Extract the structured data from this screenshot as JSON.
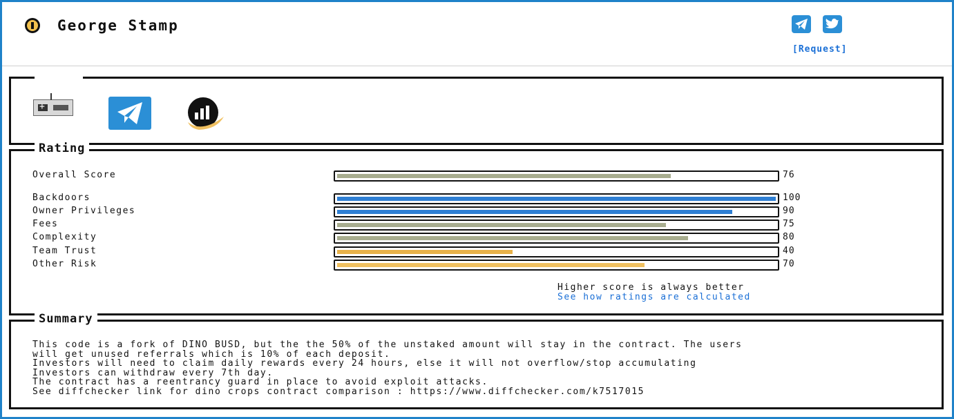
{
  "header": {
    "title": "George Stamp",
    "request_label": "[Request]",
    "social_icons": [
      "telegram-icon",
      "twitter-icon"
    ]
  },
  "links": {
    "icons": [
      "gamepad-icon",
      "telegram-icon",
      "dex-chart-icon"
    ]
  },
  "rating": {
    "legend": "Rating",
    "rows": [
      {
        "label": "Overall Score",
        "value": 76,
        "color": "#a8ad8f"
      },
      {
        "label": "Backdoors",
        "value": 100,
        "color": "#2f7fd3"
      },
      {
        "label": "Owner Privileges",
        "value": 90,
        "color": "#2f7fd3"
      },
      {
        "label": "Fees",
        "value": 75,
        "color": "#a8ad8f"
      },
      {
        "label": "Complexity",
        "value": 80,
        "color": "#a8ad8f"
      },
      {
        "label": "Team Trust",
        "value": 40,
        "color": "#e8b24a"
      },
      {
        "label": "Other Risk",
        "value": 70,
        "color": "#f0c060"
      }
    ],
    "note": "Higher score is always better",
    "calc_link": "See how ratings are calculated"
  },
  "summary": {
    "legend": "Summary",
    "text": "This code is a fork of DINO BUSD, but the the 50% of the unstaked amount will stay in the contract. The users\nwill get unused referrals which is 10% of each deposit.\nInvestors will need to claim daily rewards every 24 hours, else it will not overflow/stop accumulating\nInvestors can withdraw every 7th day.\nThe contract has a reentrancy guard in place to avoid exploit attacks.\nSee diffchecker link for dino crops contract comparison : https://www.diffchecker.com/k7517015"
  }
}
